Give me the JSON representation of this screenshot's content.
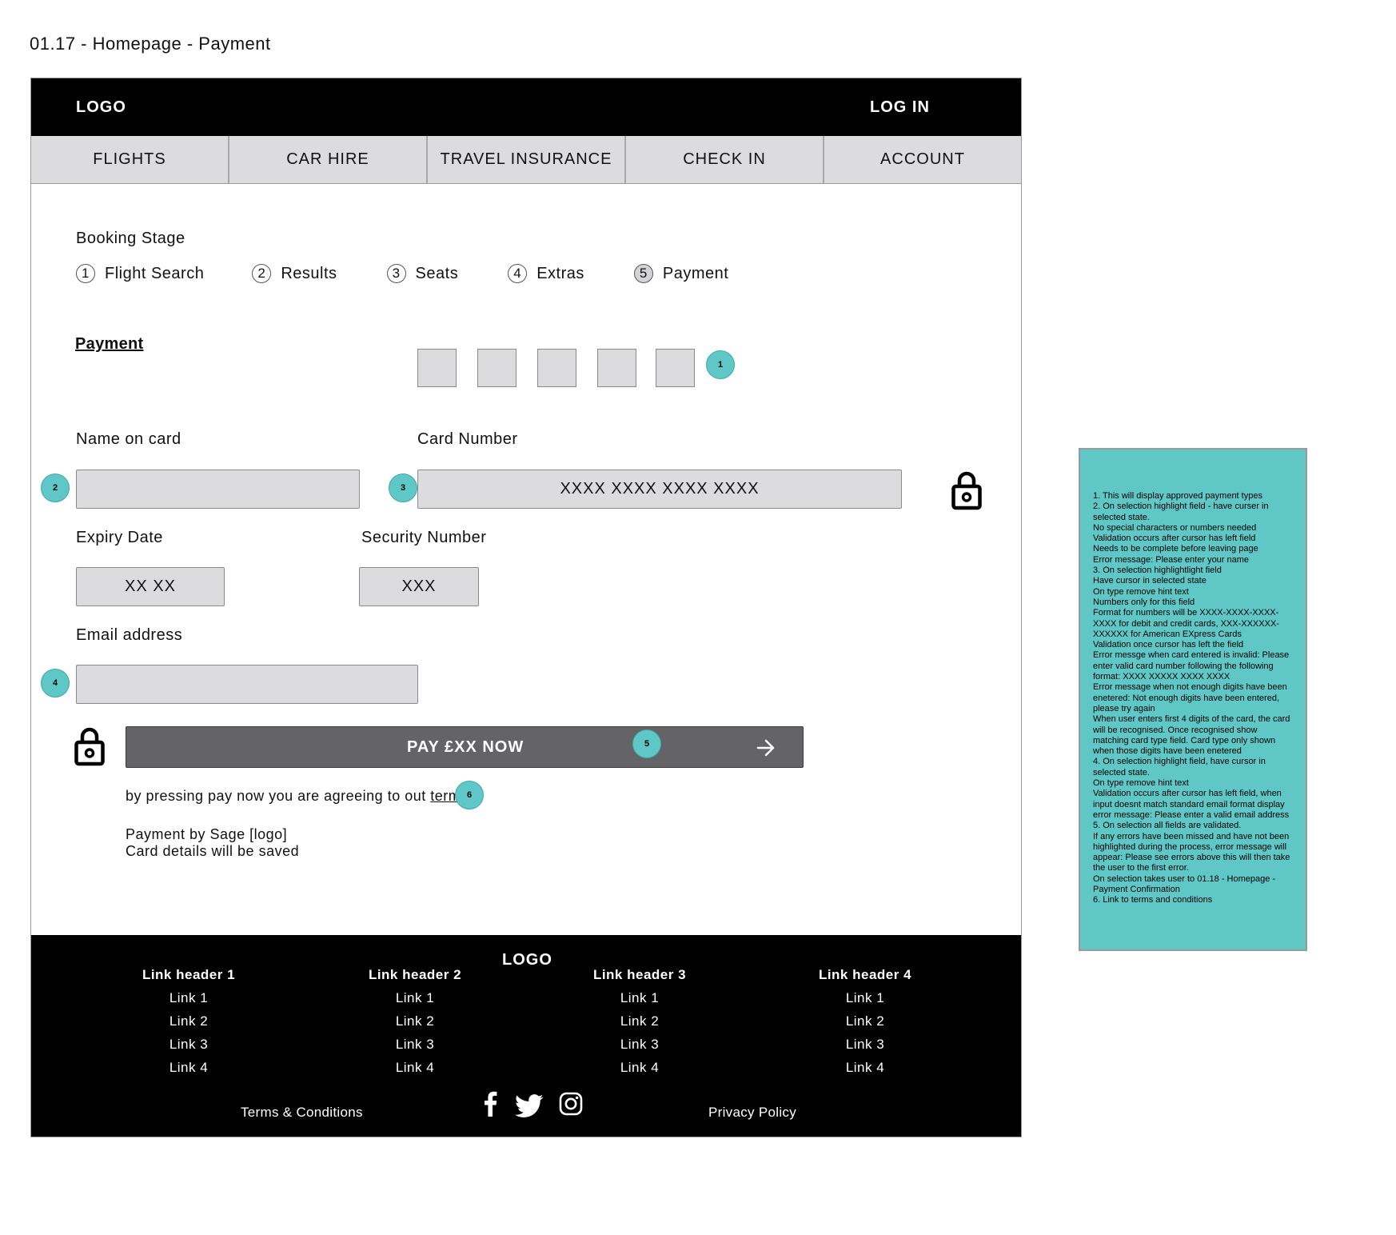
{
  "page_title": "01.17 - Homepage - Payment",
  "header": {
    "logo": "LOGO",
    "login": "LOG IN"
  },
  "nav": {
    "tabs": [
      "FLIGHTS",
      "CAR HIRE",
      "TRAVEL INSURANCE",
      "CHECK IN",
      "ACCOUNT"
    ]
  },
  "booking": {
    "heading": "Booking Stage",
    "stages": [
      {
        "num": "1",
        "label": "Flight Search"
      },
      {
        "num": "2",
        "label": "Results"
      },
      {
        "num": "3",
        "label": "Seats"
      },
      {
        "num": "4",
        "label": "Extras"
      },
      {
        "num": "5",
        "label": "Payment"
      }
    ]
  },
  "payment": {
    "heading": "Payment",
    "name_label": "Name on card",
    "card_label": "Card Number",
    "card_placeholder": "XXXX XXXX XXXX XXXX",
    "expiry_label": "Expiry Date",
    "expiry_placeholder": "XX XX",
    "security_label": "Security Number",
    "security_placeholder": "XXX",
    "email_label": "Email address",
    "pay_button": "PAY £XX NOW",
    "terms_text": "by pressing pay now you are agreeing to out ",
    "terms_link": "terms",
    "sage_line": "Payment by Sage [logo]",
    "saved_line": "Card details will be saved"
  },
  "markers": [
    "1",
    "2",
    "3",
    "4",
    "5",
    "6"
  ],
  "footer": {
    "logo": "LOGO",
    "columns": [
      {
        "header": "Link header 1",
        "links": [
          "Link 1",
          "Link 2",
          "Link 3",
          "Link 4"
        ]
      },
      {
        "header": "Link header 2",
        "links": [
          "Link 1",
          "Link 2",
          "Link 3",
          "Link 4"
        ]
      },
      {
        "header": "Link header 3",
        "links": [
          "Link 1",
          "Link 2",
          "Link 3",
          "Link 4"
        ]
      },
      {
        "header": "Link header 4",
        "links": [
          "Link 1",
          "Link 2",
          "Link 3",
          "Link 4"
        ]
      }
    ],
    "terms": "Terms & Conditions",
    "privacy": "Privacy Policy",
    "social_icons": [
      "facebook-icon",
      "twitter-icon",
      "instagram-icon"
    ]
  },
  "notes": [
    "1. This will display approved payment types",
    "2. On selection highlight field - have curser in selected state.",
    "No special characters or numbers needed",
    "Validation occurs after cursor has left field",
    "Needs to be complete before leaving page",
    "Error message: Please enter your name",
    "3. On selection highlightlight field",
    "Have cursor in selected state",
    "On type remove hint text",
    "Numbers only for this field",
    "Format for numbers will be XXXX-XXXX-XXXX-XXXX for debit and credit cards, XXX-XXXXXX-XXXXXX for American EXpress Cards",
    "Validation once cursor has left the field",
    "Error messge when card entered is invalid: Please enter valid card number following the following format: XXXX XXXXX XXXX XXXX",
    "Error message when not enough digits have been enetered: Not enough digits have been entered, please try again",
    "When user enters first 4 digits of the card, the card will be recognised. Once recognised show matching card type field. Card type only shown when those digits have been enetered",
    "4. On selection highlight field, have cursor in selected state.",
    "On type remove hint text",
    "Validation occurs after cursor has left field, when input doesnt match standard email format display error message: Please enter a valid email address",
    "5. On selection all fields are validated.",
    "If any errors have been missed and have not been highlighted during the process, error message will appear: Please see errors above this will then take the user to the first error.",
    "On selection takes user to 01.18 - Homepage - Payment Confirmation",
    "6. Link to terms and conditions"
  ],
  "colors": {
    "accent": "#5fc8c7",
    "header_bg": "#000000",
    "field_bg": "#dcdcde",
    "button_bg": "#646466"
  }
}
